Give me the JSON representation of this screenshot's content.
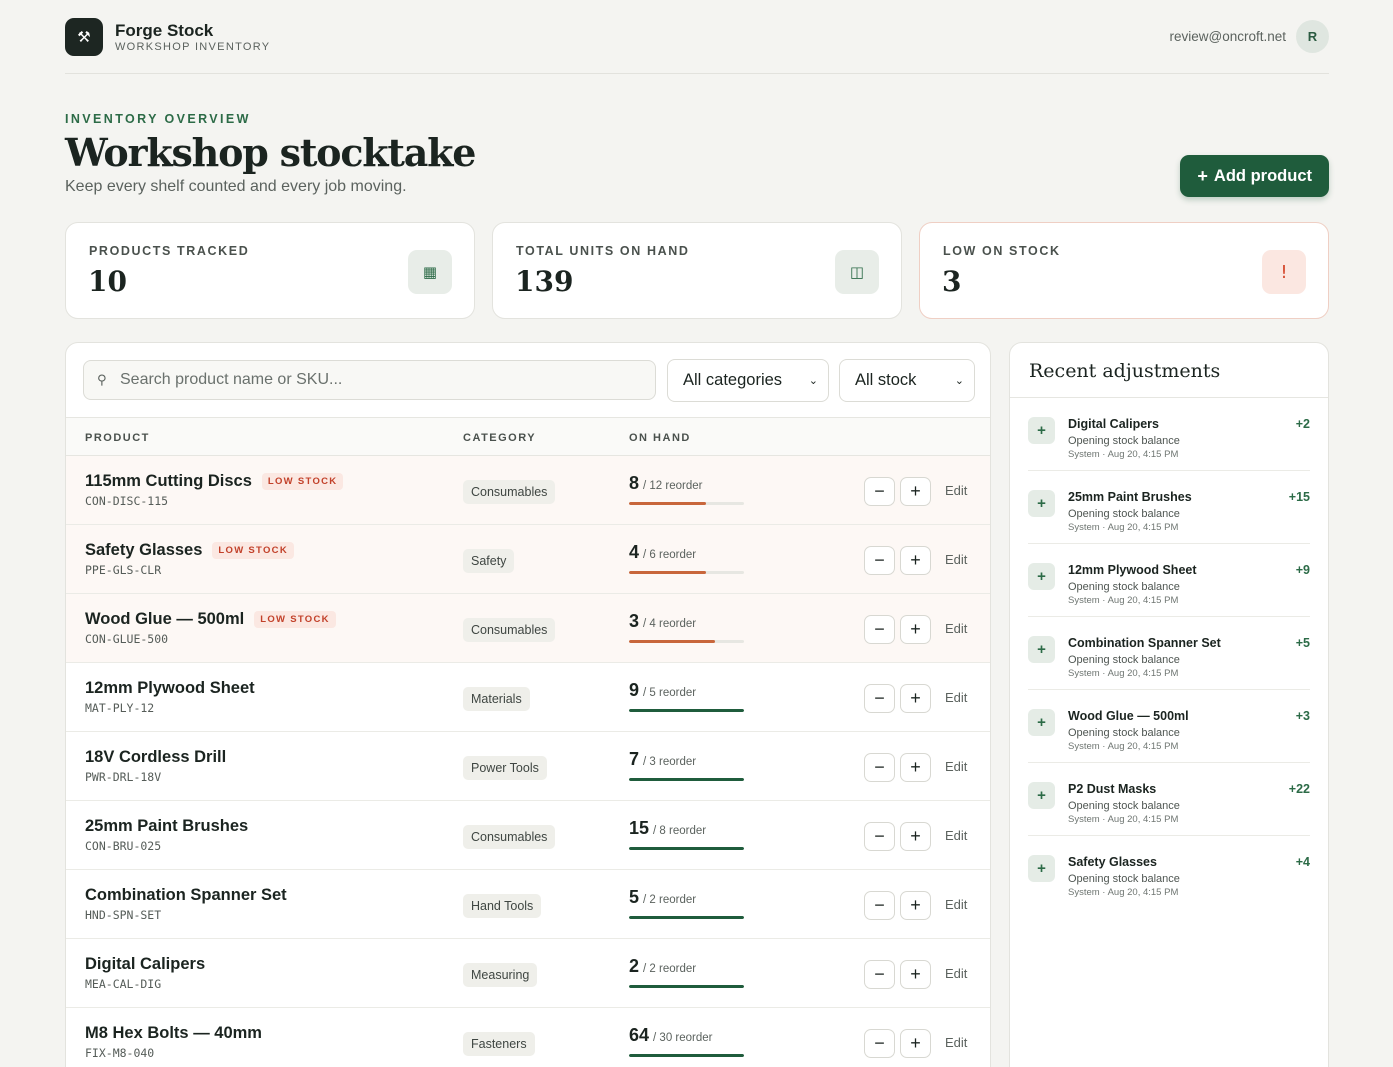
{
  "app": {
    "name": "Forge Stock",
    "subtitle": "WORKSHOP INVENTORY",
    "logo_icon": "hammer-wrench-icon",
    "user_email": "review@oncroft.net",
    "user_initial": "R"
  },
  "hero": {
    "eyebrow": "INVENTORY OVERVIEW",
    "title": "Workshop stocktake",
    "subtitle": "Keep every shelf counted and every job moving.",
    "add_button": "Add product"
  },
  "stats": [
    {
      "label": "PRODUCTS TRACKED",
      "value": "10",
      "icon": "grid-icon"
    },
    {
      "label": "TOTAL UNITS ON HAND",
      "value": "139",
      "icon": "columns-icon"
    },
    {
      "label": "LOW ON STOCK",
      "value": "3",
      "icon": "alert-icon"
    }
  ],
  "filters": {
    "search_placeholder": "Search product name or SKU...",
    "category_value": "All categories",
    "stock_value": "All stock"
  },
  "table": {
    "headers": {
      "product": "PRODUCT",
      "category": "CATEGORY",
      "on_hand": "ON HAND"
    },
    "low_badge": "LOW STOCK",
    "edit_label": "Edit",
    "rows": [
      {
        "name": "115mm Cutting Discs",
        "sku": "CON-DISC-115",
        "category": "Consumables",
        "on_hand": "8",
        "reorder": "/ 12 reorder",
        "low": true,
        "level": 0.67
      },
      {
        "name": "Safety Glasses",
        "sku": "PPE-GLS-CLR",
        "category": "Safety",
        "on_hand": "4",
        "reorder": "/ 6 reorder",
        "low": true,
        "level": 0.67
      },
      {
        "name": "Wood Glue — 500ml",
        "sku": "CON-GLUE-500",
        "category": "Consumables",
        "on_hand": "3",
        "reorder": "/ 4 reorder",
        "low": true,
        "level": 0.75
      },
      {
        "name": "12mm Plywood Sheet",
        "sku": "MAT-PLY-12",
        "category": "Materials",
        "on_hand": "9",
        "reorder": "/ 5 reorder",
        "low": false,
        "level": 1
      },
      {
        "name": "18V Cordless Drill",
        "sku": "PWR-DRL-18V",
        "category": "Power Tools",
        "on_hand": "7",
        "reorder": "/ 3 reorder",
        "low": false,
        "level": 1
      },
      {
        "name": "25mm Paint Brushes",
        "sku": "CON-BRU-025",
        "category": "Consumables",
        "on_hand": "15",
        "reorder": "/ 8 reorder",
        "low": false,
        "level": 1
      },
      {
        "name": "Combination Spanner Set",
        "sku": "HND-SPN-SET",
        "category": "Hand Tools",
        "on_hand": "5",
        "reorder": "/ 2 reorder",
        "low": false,
        "level": 1
      },
      {
        "name": "Digital Calipers",
        "sku": "MEA-CAL-DIG",
        "category": "Measuring",
        "on_hand": "2",
        "reorder": "/ 2 reorder",
        "low": false,
        "level": 1
      },
      {
        "name": "M8 Hex Bolts — 40mm",
        "sku": "FIX-M8-040",
        "category": "Fasteners",
        "on_hand": "64",
        "reorder": "/ 30 reorder",
        "low": false,
        "level": 1
      }
    ]
  },
  "recent": {
    "title": "Recent adjustments",
    "items": [
      {
        "name": "Digital Calipers",
        "reason": "Opening stock balance",
        "meta": "System · Aug 20, 4:15 PM",
        "delta": "+2"
      },
      {
        "name": "25mm Paint Brushes",
        "reason": "Opening stock balance",
        "meta": "System · Aug 20, 4:15 PM",
        "delta": "+15"
      },
      {
        "name": "12mm Plywood Sheet",
        "reason": "Opening stock balance",
        "meta": "System · Aug 20, 4:15 PM",
        "delta": "+9"
      },
      {
        "name": "Combination Spanner Set",
        "reason": "Opening stock balance",
        "meta": "System · Aug 20, 4:15 PM",
        "delta": "+5"
      },
      {
        "name": "Wood Glue — 500ml",
        "reason": "Opening stock balance",
        "meta": "System · Aug 20, 4:15 PM",
        "delta": "+3"
      },
      {
        "name": "P2 Dust Masks",
        "reason": "Opening stock balance",
        "meta": "System · Aug 20, 4:15 PM",
        "delta": "+22"
      },
      {
        "name": "Safety Glasses",
        "reason": "Opening stock balance",
        "meta": "System · Aug 20, 4:15 PM",
        "delta": "+4"
      }
    ]
  },
  "colors": {
    "accent": "#1f5c3c",
    "ok_bar": "#1f5c3c",
    "low_bar": "#c8663b",
    "low_badge": "#c2412a"
  }
}
